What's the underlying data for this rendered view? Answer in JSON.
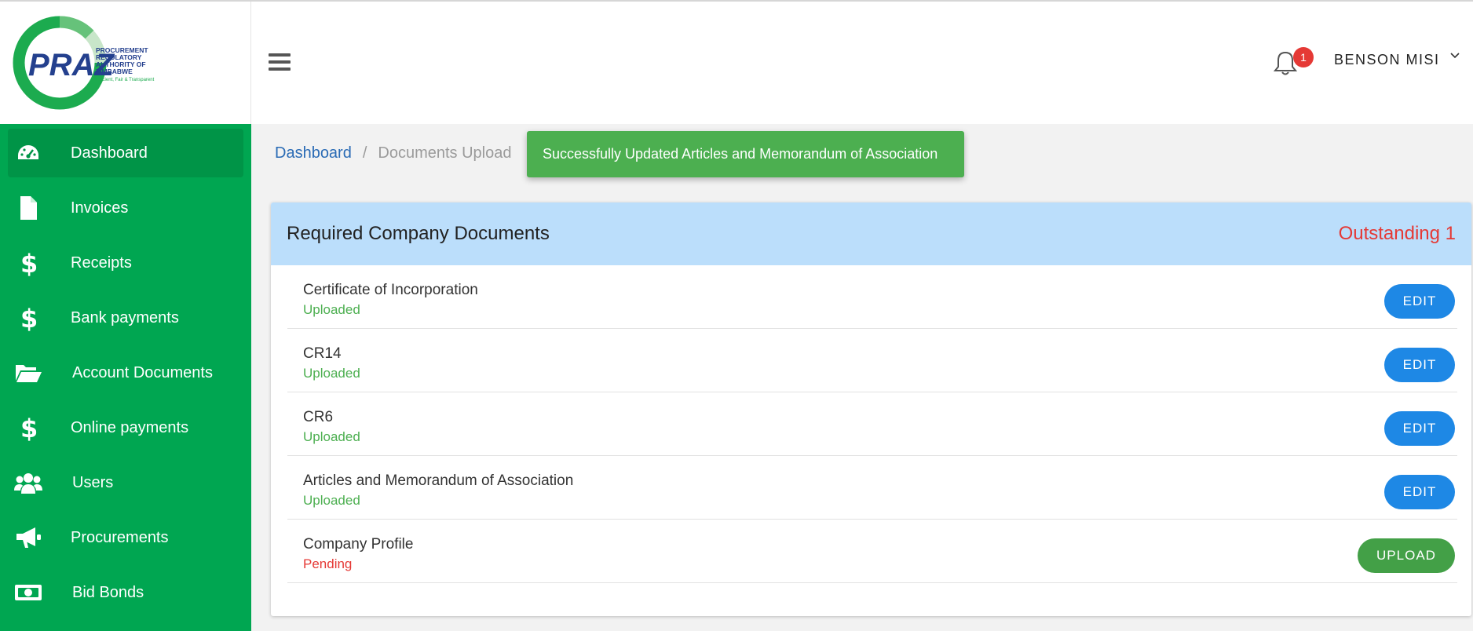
{
  "logo": {
    "mark": "PRAZ",
    "line1": "PROCUREMENT",
    "line2": "REGULATORY",
    "line3": "AUTHORITY OF",
    "line4": "ZIMBABWE",
    "tagline": "Efficient, Fair & Transparent"
  },
  "sidebar": {
    "items": [
      {
        "label": "Dashboard",
        "icon": "dashboard-icon"
      },
      {
        "label": "Invoices",
        "icon": "file-icon"
      },
      {
        "label": "Receipts",
        "icon": "dollar-icon"
      },
      {
        "label": "Bank payments",
        "icon": "dollar-icon"
      },
      {
        "label": "Account Documents",
        "icon": "folder-open-icon"
      },
      {
        "label": "Online payments",
        "icon": "dollar-icon"
      },
      {
        "label": "Users",
        "icon": "users-icon"
      },
      {
        "label": "Procurements",
        "icon": "megaphone-icon"
      },
      {
        "label": "Bid Bonds",
        "icon": "money-bill-icon"
      }
    ]
  },
  "header": {
    "notification_count": "1",
    "user_name": "BENSON MISI"
  },
  "breadcrumb": {
    "home": "Dashboard",
    "separator": "/",
    "current": "Documents Upload"
  },
  "toast": {
    "message": "Successfully Updated Articles and Memorandum of Association"
  },
  "card": {
    "title": "Required Company Documents",
    "outstanding": "Outstanding 1",
    "documents": [
      {
        "name": "Certificate of Incorporation",
        "status": "Uploaded",
        "action": "EDIT"
      },
      {
        "name": "CR14",
        "status": "Uploaded",
        "action": "EDIT"
      },
      {
        "name": "CR6",
        "status": "Uploaded",
        "action": "EDIT"
      },
      {
        "name": "Articles and Memorandum of Association",
        "status": "Uploaded",
        "action": "EDIT"
      },
      {
        "name": "Company Profile",
        "status": "Pending",
        "action": "UPLOAD"
      }
    ]
  },
  "colors": {
    "sidebar": "#00a651",
    "sidebar_active": "#009447",
    "edit_button": "#1e88e5",
    "upload_button": "#43a047",
    "uploaded_status": "#4caf50",
    "pending_status": "#e53935",
    "card_header": "#bbdefb",
    "toast": "#4caf50"
  }
}
